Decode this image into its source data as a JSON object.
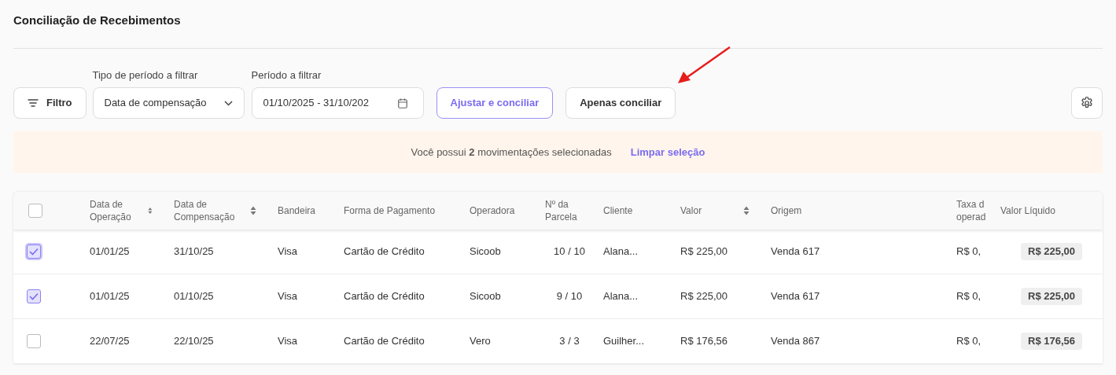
{
  "page_title": "Conciliação de Recebimentos",
  "toolbar": {
    "filter_button": "Filtro",
    "period_type": {
      "label": "Tipo de período a filtrar",
      "value": "Data de compensação"
    },
    "period": {
      "label": "Período a filtrar",
      "value": "01/10/2025 - 31/10/202"
    },
    "buttons": [
      {
        "label": "Ajustar e conciliar",
        "kind": "outlined"
      },
      {
        "label": "Apenas conciliar",
        "kind": "plain"
      }
    ]
  },
  "selection_banner": {
    "text": "Você possui **2** movimentações selecionadas",
    "link": "Limpar seleção"
  },
  "table": {
    "select_all_checked": false,
    "columns": [
      {
        "label": "Data de Operação",
        "sortable": true
      },
      {
        "label": "Data de Compensação",
        "sortable": true
      },
      {
        "label": "Bandeira",
        "sortable": false
      },
      {
        "label": "Forma de Pagamento",
        "sortable": false
      },
      {
        "label": "Operadora",
        "sortable": false
      },
      {
        "label": "Nº da Parcela",
        "sortable": false
      },
      {
        "label": "Cliente",
        "sortable": false
      },
      {
        "label": "Valor",
        "sortable": true
      },
      {
        "label": "Origem",
        "sortable": false
      },
      {
        "label": "Taxa d operad",
        "sortable": false
      },
      {
        "label": "Valor Líquido",
        "sortable": false
      }
    ],
    "rows": [
      {
        "selected": true,
        "focused": true,
        "cells": [
          "01/01/25",
          "31/10/25",
          "Visa",
          "Cartão de Crédito",
          "Sicoob",
          "10 / 10",
          "Alana...",
          "R$ 225,00",
          "Venda 617",
          "R$ 0,",
          "R$ 225,00"
        ]
      },
      {
        "selected": true,
        "focused": false,
        "cells": [
          "01/01/25",
          "01/10/25",
          "Visa",
          "Cartão de Crédito",
          "Sicoob",
          "9 / 10",
          "Alana...",
          "R$ 225,00",
          "Venda 617",
          "R$ 0,",
          "R$ 225,00"
        ]
      },
      {
        "selected": false,
        "focused": false,
        "cells": [
          "22/07/25",
          "22/10/25",
          "Visa",
          "Cartão de Crédito",
          "Vero",
          "3 / 3",
          "Guilher...",
          "R$ 176,56",
          "Venda 867",
          "R$ 0,",
          "R$ 176,56"
        ]
      }
    ]
  }
}
